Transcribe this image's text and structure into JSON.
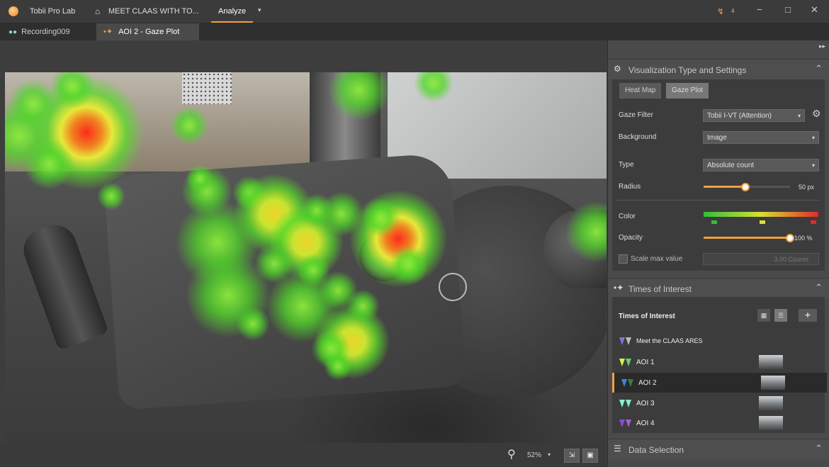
{
  "app": {
    "name": "Tobii Pro Lab",
    "project": "MEET CLAAS WITH TO...",
    "mode_tab": "Analyze",
    "notification_count": "4"
  },
  "tabs": [
    {
      "label": "Recording009",
      "icon": "recording-icon"
    },
    {
      "label": "AOI 2 - Gaze Plot",
      "icon": "gaze-plot-icon"
    }
  ],
  "viewer": {
    "zoom": "52%"
  },
  "visualization": {
    "section_title": "Visualization Type and Settings",
    "modes": [
      "Heat Map",
      "Gaze Plot"
    ],
    "active_mode": "Heat Map",
    "gaze_filter_label": "Gaze Filter",
    "gaze_filter_value": "Tobii I-VT (Attention)",
    "background_label": "Background",
    "background_value": "Image",
    "type_label": "Type",
    "type_value": "Absolute count",
    "radius_label": "Radius",
    "radius_value": "50 px",
    "radius_level": 0.48,
    "color_label": "Color",
    "opacity_label": "Opacity",
    "opacity_value": "100 %",
    "opacity_level": 1.0,
    "scale_max_label": "Scale max value",
    "scale_max_value": "3.00 Counts"
  },
  "times_of_interest": {
    "section_title": "Times of Interest",
    "list_title": "Times of Interest",
    "items": [
      {
        "label": "Meet the CLAAS ARES",
        "selected": false,
        "has_thumb": false
      },
      {
        "label": "AOI 1",
        "selected": false,
        "has_thumb": true
      },
      {
        "label": "AOI 2",
        "selected": true,
        "has_thumb": true
      },
      {
        "label": "AOI 3",
        "selected": false,
        "has_thumb": true
      },
      {
        "label": "AOI 4",
        "selected": false,
        "has_thumb": true
      }
    ]
  },
  "data_selection": {
    "section_title": "Data Selection"
  },
  "colors": {
    "accent": "#f0a040",
    "heat_low": "#2fbf3a",
    "heat_mid": "#d8e030",
    "heat_high": "#e02a2a"
  }
}
